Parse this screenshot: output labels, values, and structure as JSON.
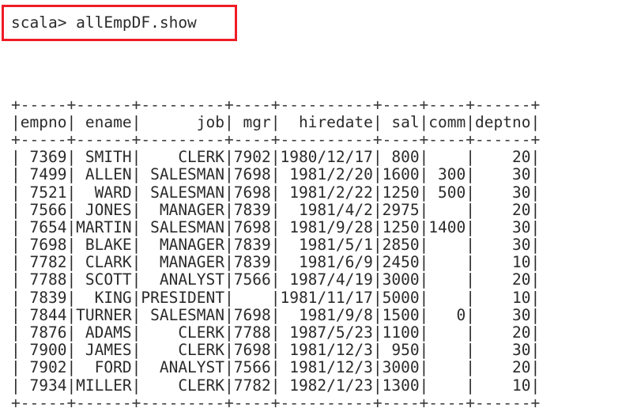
{
  "terminal": {
    "prompt": "scala> ",
    "command": "allEmpDF.show",
    "prompt_line": "scala> allEmpDF.show",
    "annotation_color": "#ee1c25",
    "text_color": "#2b2b2b",
    "background_color": "#ffffff"
  },
  "table": {
    "border_color": "#3a3a3a",
    "separator": "+-----+------+---------+----+----------+----+----+------+",
    "columns": [
      {
        "name": "empno",
        "width": 5,
        "align": "right"
      },
      {
        "name": "ename",
        "width": 6,
        "align": "right"
      },
      {
        "name": "job",
        "width": 9,
        "align": "right"
      },
      {
        "name": "mgr",
        "width": 4,
        "align": "right"
      },
      {
        "name": "hiredate",
        "width": 10,
        "align": "right"
      },
      {
        "name": "sal",
        "width": 4,
        "align": "right"
      },
      {
        "name": "comm",
        "width": 4,
        "align": "right"
      },
      {
        "name": "deptno",
        "width": 6,
        "align": "right"
      }
    ],
    "header_labels": [
      "empno",
      "ename",
      "job",
      "mgr",
      "hiredate",
      "sal",
      "comm",
      "deptno"
    ],
    "rows": [
      {
        "empno": "7369",
        "ename": "SMITH",
        "job": "CLERK",
        "mgr": "7902",
        "hiredate": "1980/12/17",
        "sal": "800",
        "comm": "",
        "deptno": "20"
      },
      {
        "empno": "7499",
        "ename": "ALLEN",
        "job": "SALESMAN",
        "mgr": "7698",
        "hiredate": "1981/2/20",
        "sal": "1600",
        "comm": "300",
        "deptno": "30"
      },
      {
        "empno": "7521",
        "ename": "WARD",
        "job": "SALESMAN",
        "mgr": "7698",
        "hiredate": "1981/2/22",
        "sal": "1250",
        "comm": "500",
        "deptno": "30"
      },
      {
        "empno": "7566",
        "ename": "JONES",
        "job": "MANAGER",
        "mgr": "7839",
        "hiredate": "1981/4/2",
        "sal": "2975",
        "comm": "",
        "deptno": "20"
      },
      {
        "empno": "7654",
        "ename": "MARTIN",
        "job": "SALESMAN",
        "mgr": "7698",
        "hiredate": "1981/9/28",
        "sal": "1250",
        "comm": "1400",
        "deptno": "30"
      },
      {
        "empno": "7698",
        "ename": "BLAKE",
        "job": "MANAGER",
        "mgr": "7839",
        "hiredate": "1981/5/1",
        "sal": "2850",
        "comm": "",
        "deptno": "30"
      },
      {
        "empno": "7782",
        "ename": "CLARK",
        "job": "MANAGER",
        "mgr": "7839",
        "hiredate": "1981/6/9",
        "sal": "2450",
        "comm": "",
        "deptno": "10"
      },
      {
        "empno": "7788",
        "ename": "SCOTT",
        "job": "ANALYST",
        "mgr": "7566",
        "hiredate": "1987/4/19",
        "sal": "3000",
        "comm": "",
        "deptno": "20"
      },
      {
        "empno": "7839",
        "ename": "KING",
        "job": "PRESIDENT",
        "mgr": "",
        "hiredate": "1981/11/17",
        "sal": "5000",
        "comm": "",
        "deptno": "10"
      },
      {
        "empno": "7844",
        "ename": "TURNER",
        "job": "SALESMAN",
        "mgr": "7698",
        "hiredate": "1981/9/8",
        "sal": "1500",
        "comm": "0",
        "deptno": "30"
      },
      {
        "empno": "7876",
        "ename": "ADAMS",
        "job": "CLERK",
        "mgr": "7788",
        "hiredate": "1987/5/23",
        "sal": "1100",
        "comm": "",
        "deptno": "20"
      },
      {
        "empno": "7900",
        "ename": "JAMES",
        "job": "CLERK",
        "mgr": "7698",
        "hiredate": "1981/12/3",
        "sal": "950",
        "comm": "",
        "deptno": "30"
      },
      {
        "empno": "7902",
        "ename": "FORD",
        "job": "ANALYST",
        "mgr": "7566",
        "hiredate": "1981/12/3",
        "sal": "3000",
        "comm": "",
        "deptno": "20"
      },
      {
        "empno": "7934",
        "ename": "MILLER",
        "job": "CLERK",
        "mgr": "7782",
        "hiredate": "1982/1/23",
        "sal": "1300",
        "comm": "",
        "deptno": "10"
      }
    ]
  }
}
